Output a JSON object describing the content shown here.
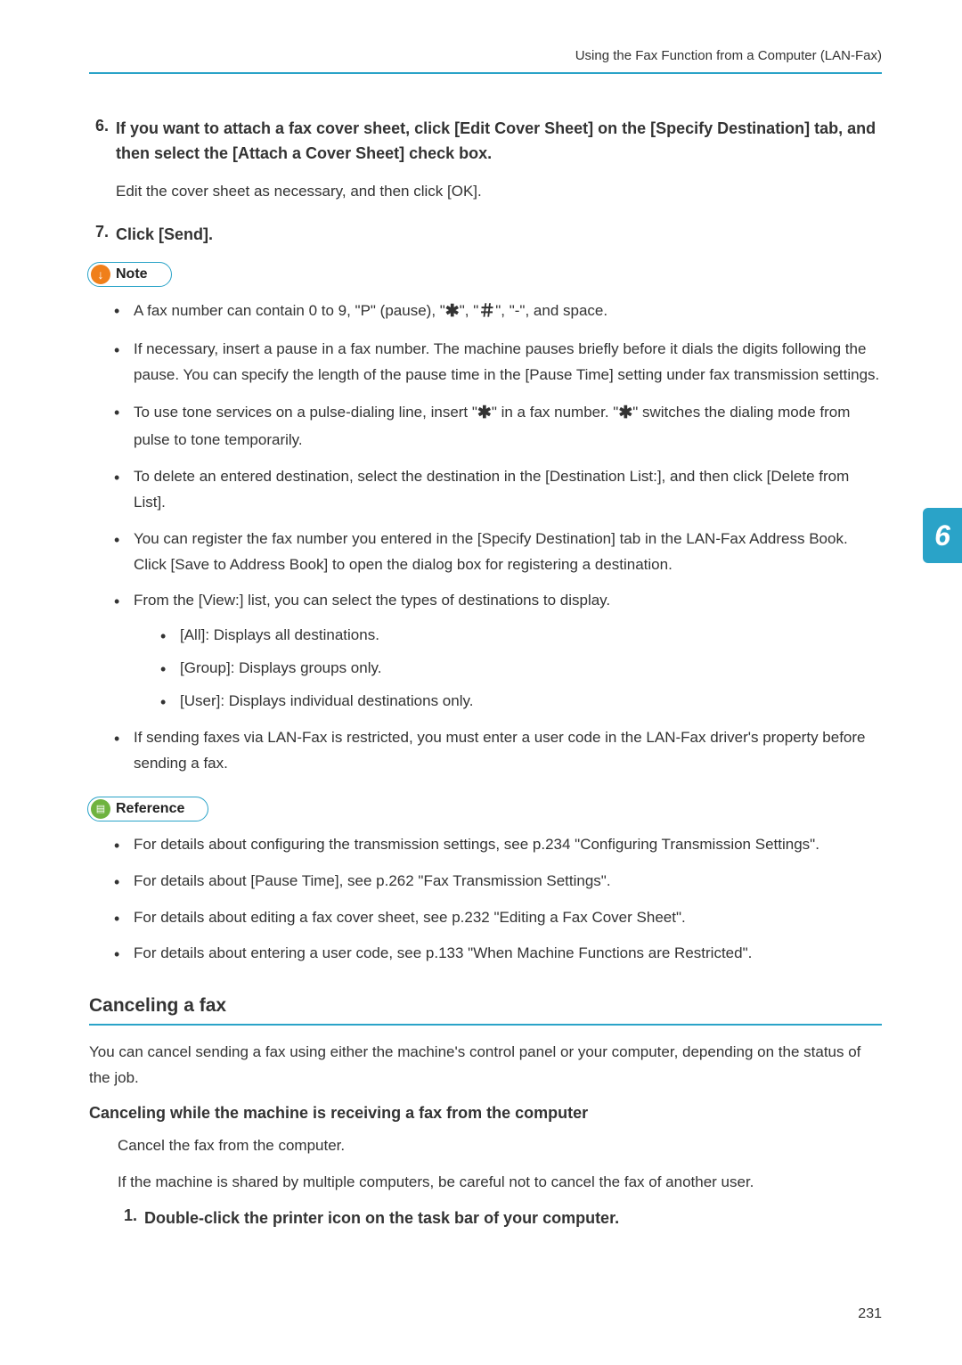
{
  "header": {
    "running_title": "Using the Fax Function from a Computer (LAN-Fax)"
  },
  "step6": {
    "num": "6.",
    "title": "If you want to attach a fax cover sheet, click [Edit Cover Sheet] on the [Specify Destination] tab, and then select the [Attach a Cover Sheet] check box.",
    "text": "Edit the cover sheet as necessary, and then click [OK]."
  },
  "step7": {
    "num": "7.",
    "title": "Click [Send]."
  },
  "note": {
    "label": "Note",
    "items": {
      "i0a": "A fax number can contain 0 to 9, \"P\" (pause), \"",
      "i0b": "\", \"",
      "i0c": "\", \"-\", and space.",
      "i1": "If necessary, insert a pause in a fax number. The machine pauses briefly before it dials the digits following the pause. You can specify the length of the pause time in the [Pause Time] setting under fax transmission settings.",
      "i2a": "To use tone services on a pulse-dialing line, insert \"",
      "i2b": "\" in a fax number. \"",
      "i2c": "\" switches the dialing mode from pulse to tone temporarily.",
      "i3": "To delete an entered destination, select the destination in the [Destination List:], and then click [Delete from List].",
      "i4": "You can register the fax number you entered in the [Specify Destination] tab in the LAN-Fax Address Book. Click [Save to Address Book] to open the dialog box for registering a destination.",
      "i5": "From the [View:] list, you can select the types of destinations to display.",
      "i5_sub": {
        "s0": "[All]: Displays all destinations.",
        "s1": "[Group]: Displays groups only.",
        "s2": "[User]: Displays individual destinations only."
      },
      "i6": "If sending faxes via LAN-Fax is restricted, you must enter a user code in the LAN-Fax driver's property before sending a fax."
    }
  },
  "reference": {
    "label": "Reference",
    "items": {
      "r0": "For details about configuring the transmission settings, see p.234 \"Configuring Transmission Settings\".",
      "r1": "For details about [Pause Time], see p.262 \"Fax Transmission Settings\".",
      "r2": "For details about editing a fax cover sheet, see p.232 \"Editing a Fax Cover Sheet\".",
      "r3": "For details about entering a user code, see p.133 \"When Machine Functions are Restricted\"."
    }
  },
  "cancel_section": {
    "heading": "Canceling a fax",
    "intro": "You can cancel sending a fax using either the machine's control panel or your computer, depending on the status of the job.",
    "sub_heading": "Canceling while the machine is receiving a fax from the computer",
    "line1": "Cancel the fax from the computer.",
    "line2": "If the machine is shared by multiple computers, be careful not to cancel the fax of another user.",
    "step1_num": "1.",
    "step1_text": "Double-click the printer icon on the task bar of your computer."
  },
  "side_tab": "6",
  "page_number": "231",
  "symbols": {
    "star": "✱",
    "hash": "＃"
  }
}
